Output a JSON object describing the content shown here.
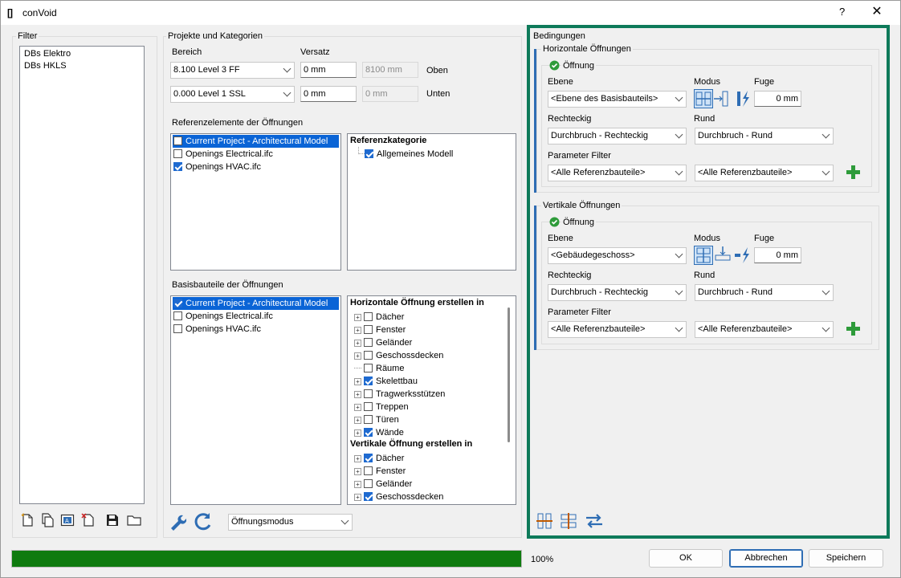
{
  "window": {
    "app_icon": "[]",
    "title": "conVoid",
    "help_label": "?",
    "close_label": "✕"
  },
  "filter": {
    "label": "Filter",
    "items": [
      "DBs Elektro",
      "DBs HKLS"
    ]
  },
  "projects": {
    "label": "Projekte und Kategorien",
    "bereich_label": "Bereich",
    "versatz_label": "Versatz",
    "top_level": "8.100  Level 3 FF",
    "top_offset": "0 mm",
    "top_computed": "8100 mm",
    "top_side": "Oben",
    "bottom_level": "0.000  Level 1 SSL",
    "bottom_offset": "0 mm",
    "bottom_computed": "0 mm",
    "bottom_side": "Unten",
    "ref_elements_label": "Referenzelemente der Öffnungen",
    "ref_elements": [
      {
        "label": "Current Project - Architectural Model",
        "checked": false,
        "selected": true
      },
      {
        "label": "Openings Electrical.ifc",
        "checked": false,
        "selected": false
      },
      {
        "label": "Openings HVAC.ifc",
        "checked": true,
        "selected": false
      }
    ],
    "ref_category_header": "Referenzkategorie",
    "ref_category_item": "Allgemeines Modell",
    "base_elements_label": "Basisbauteile der Öffnungen",
    "base_elements": [
      {
        "label": "Current Project - Architectural Model",
        "checked": true,
        "selected": true
      },
      {
        "label": "Openings Electrical.ifc",
        "checked": false,
        "selected": false
      },
      {
        "label": "Openings HVAC.ifc",
        "checked": false,
        "selected": false
      }
    ],
    "horiz_header": "Horizontale Öffnung erstellen in",
    "horiz_items": [
      {
        "label": "Dächer",
        "checked": false,
        "expandable": true
      },
      {
        "label": "Fenster",
        "checked": false,
        "expandable": true
      },
      {
        "label": "Geländer",
        "checked": false,
        "expandable": true
      },
      {
        "label": "Geschossdecken",
        "checked": false,
        "expandable": true
      },
      {
        "label": "Räume",
        "checked": false,
        "expandable": false
      },
      {
        "label": "Skelettbau",
        "checked": true,
        "expandable": true
      },
      {
        "label": "Tragwerksstützen",
        "checked": false,
        "expandable": true
      },
      {
        "label": "Treppen",
        "checked": false,
        "expandable": true
      },
      {
        "label": "Türen",
        "checked": false,
        "expandable": true
      },
      {
        "label": "Wände",
        "checked": true,
        "expandable": true
      }
    ],
    "vert_header": "Vertikale Öffnung erstellen in",
    "vert_items": [
      {
        "label": "Dächer",
        "checked": true,
        "expandable": true
      },
      {
        "label": "Fenster",
        "checked": false,
        "expandable": true
      },
      {
        "label": "Geländer",
        "checked": false,
        "expandable": true
      },
      {
        "label": "Geschossdecken",
        "checked": true,
        "expandable": true
      }
    ],
    "mode_select": "Öffnungsmodus"
  },
  "conditions": {
    "label": "Bedingungen",
    "horizontal": {
      "label": "Horizontale Öffnungen",
      "opening_label": "Öffnung",
      "ebene_label": "Ebene",
      "modus_label": "Modus",
      "fuge_label": "Fuge",
      "ebene_value": "<Ebene des Basisbauteils>",
      "fuge_value": "0 mm",
      "rechteckig_label": "Rechteckig",
      "rund_label": "Rund",
      "rechteckig_value": "Durchbruch - Rechteckig",
      "rund_value": "Durchbruch - Rund",
      "param_label": "Parameter Filter",
      "param_left": "<Alle Referenzbauteile>",
      "param_right": "<Alle Referenzbauteile>"
    },
    "vertical": {
      "label": "Vertikale Öffnungen",
      "opening_label": "Öffnung",
      "ebene_label": "Ebene",
      "modus_label": "Modus",
      "fuge_label": "Fuge",
      "ebene_value": "<Gebäudegeschoss>",
      "fuge_value": "0 mm",
      "rechteckig_label": "Rechteckig",
      "rund_label": "Rund",
      "rechteckig_value": "Durchbruch - Rechteckig",
      "rund_value": "Durchbruch - Rund",
      "param_label": "Parameter Filter",
      "param_left": "<Alle Referenzbauteile>",
      "param_right": "<Alle Referenzbauteile>"
    }
  },
  "footer": {
    "progress": 1.0,
    "progress_text": "100%",
    "ok": "OK",
    "cancel": "Abbrechen",
    "save": "Speichern"
  },
  "colors": {
    "accent": "#2e6db4",
    "frame": "#0e7a5a",
    "progress": "#0f7b0f",
    "selection": "#0a64d6",
    "add": "#2e9b3a"
  }
}
